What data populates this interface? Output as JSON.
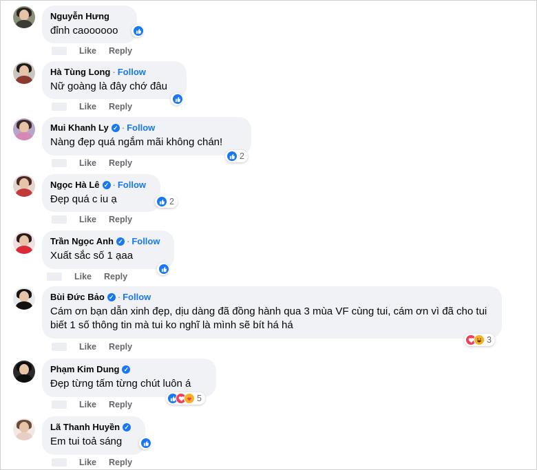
{
  "comments": [
    {
      "name": "Nguyễn Hưng",
      "verified": false,
      "follow": "",
      "text": "đỉnh caoooooo",
      "like": "Like",
      "reply": "Reply",
      "reaction_count": "",
      "reactions": [
        "like"
      ]
    },
    {
      "name": "Hà Tùng Long",
      "verified": false,
      "follow": "Follow",
      "text": "Nữ goàng là đây chớ đâu",
      "like": "Like",
      "reply": "Reply",
      "reaction_count": "",
      "reactions": [
        "like"
      ]
    },
    {
      "name": "Mui Khanh Ly",
      "verified": true,
      "follow": "Follow",
      "text": "Nàng đẹp quá ngắm mãi không chán!",
      "like": "Like",
      "reply": "Reply",
      "reaction_count": "2",
      "reactions": [
        "like"
      ]
    },
    {
      "name": "Ngọc Hà Lê",
      "verified": true,
      "follow": "Follow",
      "text": "Đẹp quá c iu ạ",
      "like": "Like",
      "reply": "Reply",
      "reaction_count": "2",
      "reactions": [
        "like"
      ]
    },
    {
      "name": "Trần Ngọc Anh",
      "verified": true,
      "follow": "Follow",
      "text": "Xuất sắc số 1 ạaa",
      "like": "Like",
      "reply": "Reply",
      "reaction_count": "",
      "reactions": [
        "like"
      ]
    },
    {
      "name": "Bùi Đức Bảo",
      "verified": true,
      "follow": "Follow",
      "text": "Cám ơn bạn dẫn xinh đẹp, dịu dàng đã đồng hành qua 3 mùa VF cùng tui, cám ơn vì đã cho tui biết 1 số thông tin mà tui ko nghĩ là mình sẽ bít há há",
      "like": "Like",
      "reply": "Reply",
      "reaction_count": "3",
      "reactions": [
        "love",
        "haha"
      ]
    },
    {
      "name": "Phạm Kim Dung",
      "verified": true,
      "follow": "",
      "text": "Đẹp từng tấm từng chút luôn á",
      "like": "Like",
      "reply": "Reply",
      "reaction_count": "5",
      "reactions": [
        "like",
        "love",
        "care"
      ]
    },
    {
      "name": "Lã Thanh Huyền",
      "verified": true,
      "follow": "",
      "text": "Em tui toả sáng",
      "like": "Like",
      "reply": "Reply",
      "reaction_count": "",
      "reactions": [
        "like"
      ]
    }
  ],
  "colors": {
    "bubble": "#f0f2f5",
    "link": "#1877f2",
    "muted": "#65676b",
    "text": "#050505"
  },
  "icons": {
    "verified": "verified-badge-icon",
    "like": "like-reaction-icon",
    "love": "love-reaction-icon",
    "haha": "haha-reaction-icon",
    "care": "care-reaction-icon"
  }
}
